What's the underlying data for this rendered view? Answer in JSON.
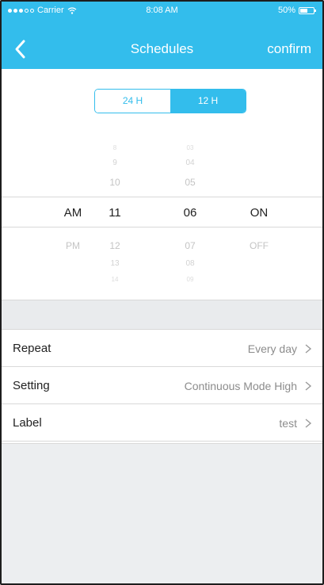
{
  "status_bar": {
    "carrier": "Carrier",
    "time": "8:08 AM",
    "battery": "50%"
  },
  "nav": {
    "title": "Schedules",
    "confirm_label": "confirm"
  },
  "format_toggle": {
    "options": [
      "24 H",
      "12 H"
    ],
    "selected": "12 H"
  },
  "picker": {
    "ampm": {
      "selected": "AM",
      "below": [
        "PM"
      ]
    },
    "hour": {
      "above": [
        "8",
        "9",
        "10"
      ],
      "selected": "11",
      "below": [
        "12",
        "13",
        "14"
      ]
    },
    "minute": {
      "above": [
        "03",
        "04",
        "05"
      ],
      "selected": "06",
      "below": [
        "07",
        "08",
        "09"
      ]
    },
    "onoff": {
      "selected": "ON",
      "below": [
        "OFF"
      ]
    }
  },
  "settings": [
    {
      "label": "Repeat",
      "value": "Every day"
    },
    {
      "label": "Setting",
      "value": "Continuous Mode High"
    },
    {
      "label": "Label",
      "value": "test"
    }
  ],
  "colors": {
    "accent": "#33bdec",
    "background_gray": "#e9ebed"
  },
  "icons": {
    "back": "chevron-left-icon",
    "row_arrow": "chevron-right-icon",
    "wifi": "wifi-icon",
    "battery": "battery-icon"
  }
}
